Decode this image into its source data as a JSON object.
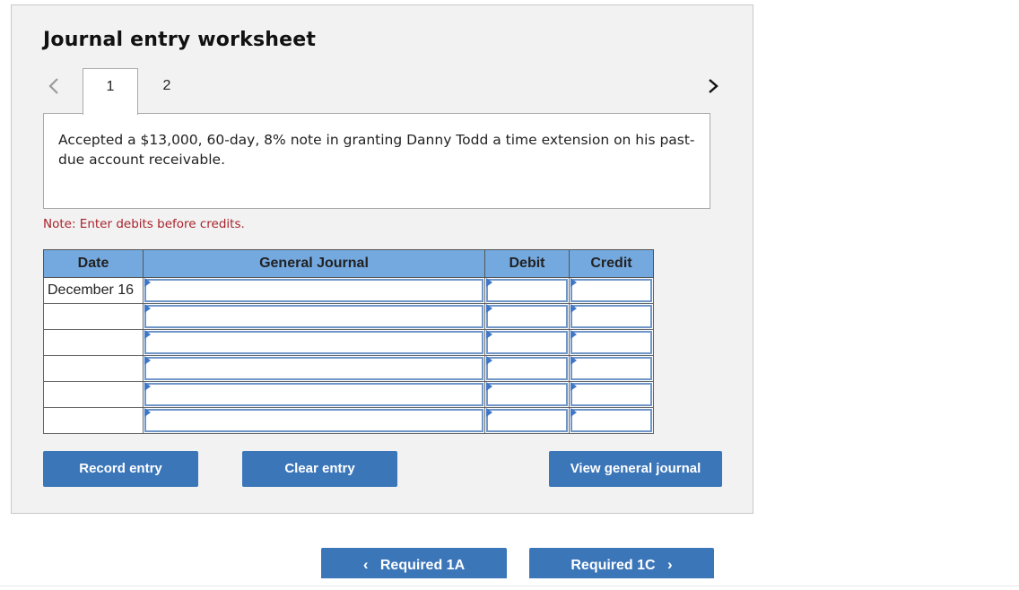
{
  "worksheet": {
    "title": "Journal entry worksheet",
    "tabs": [
      {
        "label": "1",
        "active": true
      },
      {
        "label": "2",
        "active": false
      }
    ],
    "prev_icon": "chevron-left-icon",
    "next_icon": "chevron-right-icon",
    "description": "Accepted a $13,000, 60-day, 8% note in granting Danny Todd a time extension on his past-due account receivable.",
    "note": "Note: Enter debits before credits."
  },
  "journal_table": {
    "headers": [
      "Date",
      "General Journal",
      "Debit",
      "Credit"
    ],
    "rows": [
      {
        "date": "December 16",
        "account": "",
        "debit": "",
        "credit": ""
      },
      {
        "date": "",
        "account": "",
        "debit": "",
        "credit": ""
      },
      {
        "date": "",
        "account": "",
        "debit": "",
        "credit": ""
      },
      {
        "date": "",
        "account": "",
        "debit": "",
        "credit": ""
      },
      {
        "date": "",
        "account": "",
        "debit": "",
        "credit": ""
      },
      {
        "date": "",
        "account": "",
        "debit": "",
        "credit": ""
      }
    ]
  },
  "buttons": {
    "record": "Record entry",
    "clear": "Clear entry",
    "view": "View general journal"
  },
  "navigation": {
    "prev_label": "Required 1A",
    "next_label": "Required 1C",
    "prev_chevron": "‹",
    "next_chevron": "›"
  },
  "colors": {
    "accent_button": "#3b76b9",
    "table_header": "#74a9e0",
    "note_text": "#a8232b"
  }
}
